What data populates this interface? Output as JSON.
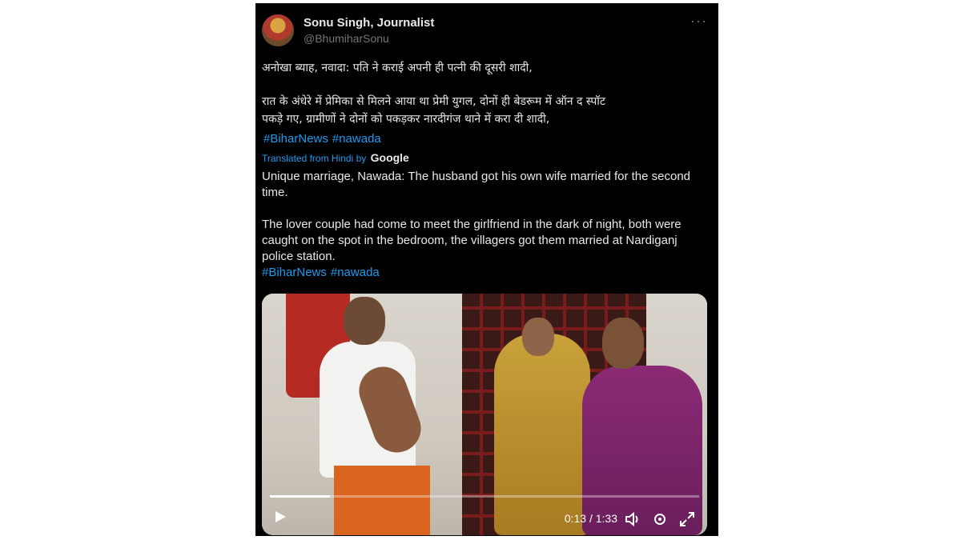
{
  "author": {
    "name": "Sonu Singh, Journalist",
    "handle": "@BhumiharSonu",
    "more_label": "···"
  },
  "hindi": {
    "line1": "अनोखा ब्याह, नवादा: पति ने कराई अपनी ही पत्नी की दूसरी शादी,",
    "line2": "रात के अंधेरे में प्रेमिका से मिलने आया था प्रेमी युगल, दोनों ही बेडरूम में ऑन द स्पॉट",
    "line3": "पकड़े गए, ग्रामीणों ने दोनों को पकड़कर नारदीगंज थाने में करा दी शादी,",
    "tags": [
      "#BiharNews",
      "#nawada"
    ]
  },
  "translation": {
    "label": "Translated from Hindi by",
    "provider": "Google"
  },
  "english": {
    "para1": "Unique marriage, Nawada: The husband got his own wife married for the second time.",
    "para2": "The lover couple had come to meet the girlfriend in the dark of night, both were caught on the spot in the bedroom, the villagers got them married at Nardiganj police station.",
    "tags": [
      "#BiharNews",
      "#nawada"
    ]
  },
  "video": {
    "time": "0:13 / 1:33",
    "progress": 0.14,
    "icons": [
      "play-icon",
      "volume-icon",
      "settings-icon",
      "fullscreen-icon"
    ]
  },
  "colors": {
    "link": "#1d9bf0",
    "background": "#000000",
    "text": "#e7e9ea",
    "muted": "#71767b"
  }
}
